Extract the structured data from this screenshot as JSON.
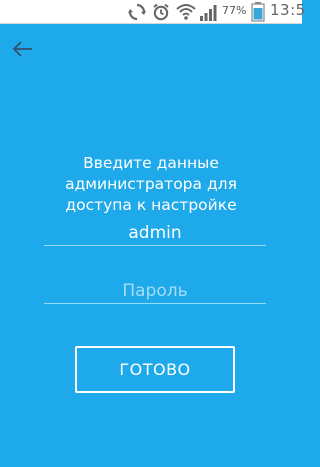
{
  "status_bar": {
    "battery_percent": "77%",
    "time": "13:5"
  },
  "login": {
    "prompt": "Введите данные администратора для доступа к настройке",
    "username_value": "admin",
    "password_placeholder": "Пароль",
    "done_label": "ГОТОВО"
  },
  "colors": {
    "background": "#1da9ea",
    "status_bar_bg": "#ffffff",
    "battery_accent": "#3aa7d9"
  }
}
